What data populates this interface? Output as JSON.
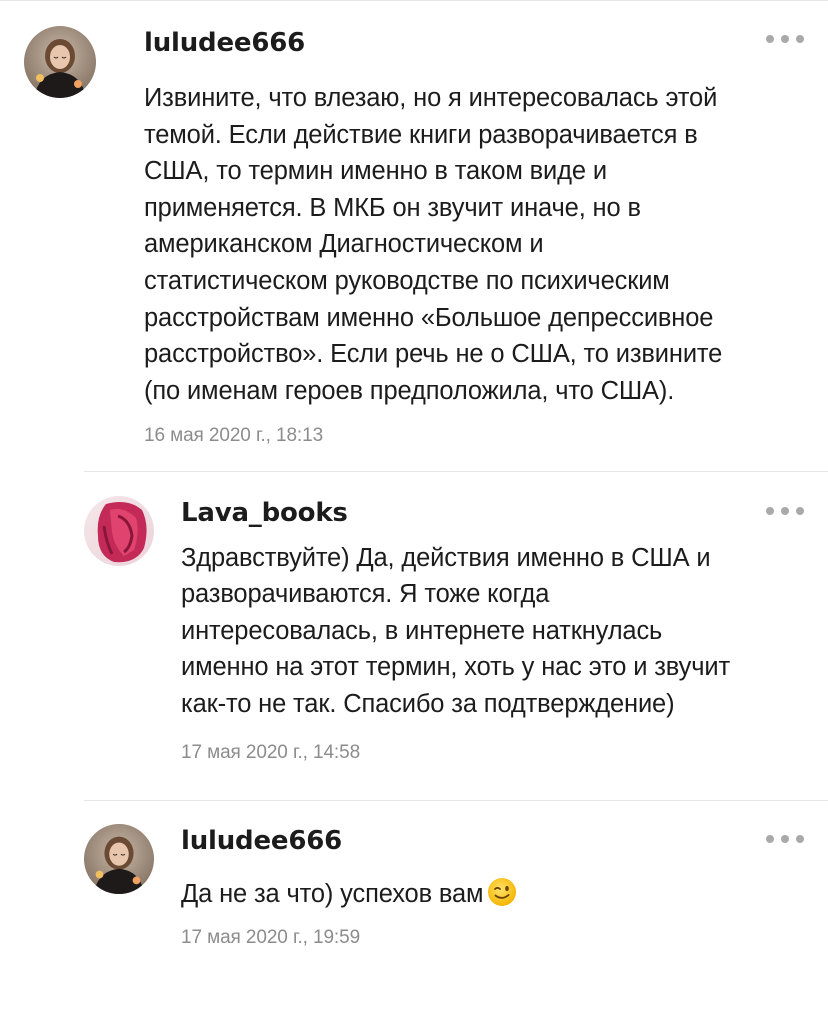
{
  "comments": [
    {
      "author": "luludee666",
      "text": "Извините, что влезаю, но я интересовалась этой\nтемой. Если действие книги разворачивается в\nСША, то термин именно в таком виде и\nприменяется. В МКБ он звучит иначе, но в\nамериканском Диагностическом и\nстатистическом руководстве по психическим\nрасстройствам именно «Большое депрессивное\nрасстройство». Если речь не о США, то извините\n(по именам героев предположила, что США).",
      "date": "16 мая 2020 г., 18:13",
      "avatar_icon": "user-photo-avatar"
    },
    {
      "author": "Lava_books",
      "text": "Здравствуйте) Да, действия именно в США и\nразворачиваются. Я тоже когда\nинтересовалась, в интернете наткнулась\nименно на этот термин, хоть у нас это и звучит\nкак-то не так. Спасибо за подтверждение)",
      "date": "17 мая 2020 г., 14:58",
      "avatar_icon": "user-photo-avatar"
    },
    {
      "author": "luludee666",
      "text": "Да не за что) успехов вам",
      "emoji": "winking-face-emoji",
      "date": "17 мая 2020 г., 19:59",
      "avatar_icon": "user-photo-avatar"
    }
  ],
  "more_menu_icon": "more-horizontal-icon",
  "colors": {
    "text": "#1c1c1c",
    "date": "#8c8c8c",
    "divider": "#e6e6e6",
    "menu_dots": "#a9a9a9",
    "avatar_pink": "#d6336c"
  }
}
